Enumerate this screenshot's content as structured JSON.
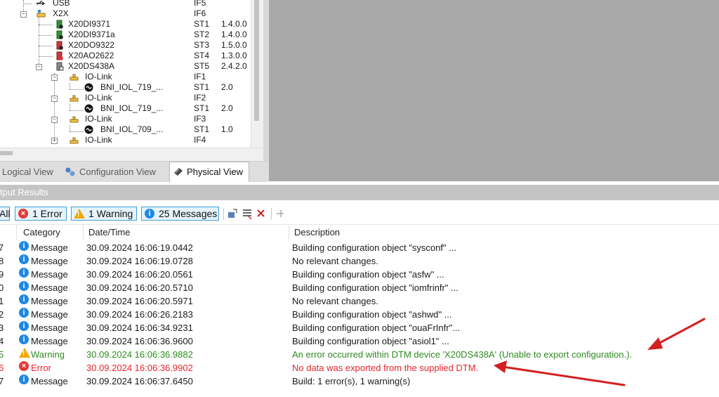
{
  "tree": {
    "items": [
      {
        "label": "USB",
        "slot": "IF5",
        "version": ""
      },
      {
        "label": "X2X",
        "slot": "IF6",
        "version": ""
      },
      {
        "label": "X20DI9371",
        "slot": "ST1",
        "version": "1.4.0.0"
      },
      {
        "label": "X20DI9371a",
        "slot": "ST2",
        "version": "1.4.0.0"
      },
      {
        "label": "X20DO9322",
        "slot": "ST3",
        "version": "1.5.0.0"
      },
      {
        "label": "X20AO2622",
        "slot": "ST4",
        "version": "1.3.0.0"
      },
      {
        "label": "X20DS438A",
        "slot": "ST5",
        "version": "2.4.2.0"
      },
      {
        "label": "IO-Link",
        "slot": "IF1",
        "version": ""
      },
      {
        "label": "BNI_IOL_719_...",
        "slot": "ST1",
        "version": "2.0"
      },
      {
        "label": "IO-Link",
        "slot": "IF2",
        "version": ""
      },
      {
        "label": "BNI_IOL_719_...",
        "slot": "ST1",
        "version": "2.0"
      },
      {
        "label": "IO-Link",
        "slot": "IF3",
        "version": ""
      },
      {
        "label": "BNI_IOL_709_...",
        "slot": "ST1",
        "version": "1.0"
      },
      {
        "label": "IO-Link",
        "slot": "IF4",
        "version": ""
      }
    ]
  },
  "view_tabs": [
    {
      "label": "Logical View",
      "icon": "logical-view-icon"
    },
    {
      "label": "Configuration View",
      "icon": "configuration-view-icon"
    },
    {
      "label": "Physical View",
      "icon": "physical-view-icon",
      "active": true
    }
  ],
  "output": {
    "title": "tput Results",
    "filters": {
      "all_label": "All",
      "error_label": "1 Error",
      "warning_label": "1 Warning",
      "messages_label": "25 Messages"
    },
    "columns": {
      "category": "Category",
      "datetime": "Date/Time",
      "description": "Description"
    },
    "rows": [
      {
        "num": "7",
        "category": "Message",
        "severity": "info",
        "datetime": "30.09.2024 16:06:19.0442",
        "description": "Building configuration object \"sysconf\" ..."
      },
      {
        "num": "8",
        "category": "Message",
        "severity": "info",
        "datetime": "30.09.2024 16:06:19.0728",
        "description": "No relevant changes."
      },
      {
        "num": "9",
        "category": "Message",
        "severity": "info",
        "datetime": "30.09.2024 16:06:20.0561",
        "description": "Building configuration object \"asfw\" ..."
      },
      {
        "num": "0",
        "category": "Message",
        "severity": "info",
        "datetime": "30.09.2024 16:06:20.5710",
        "description": "Building configuration object \"iomfrinfr\" ..."
      },
      {
        "num": "1",
        "category": "Message",
        "severity": "info",
        "datetime": "30.09.2024 16:06:20.5971",
        "description": "No relevant changes."
      },
      {
        "num": "2",
        "category": "Message",
        "severity": "info",
        "datetime": "30.09.2024 16:06:26.2183",
        "description": "Building configuration object \"ashwd\" ..."
      },
      {
        "num": "3",
        "category": "Message",
        "severity": "info",
        "datetime": "30.09.2024 16:06:34.9231",
        "description": "Building configuration object \"ouaFrInfr\"..."
      },
      {
        "num": "4",
        "category": "Message",
        "severity": "info",
        "datetime": "30.09.2024 16:06:36.9600",
        "description": "Building configuration object \"asiol1\" ..."
      },
      {
        "num": "5",
        "category": "Warning",
        "severity": "warning",
        "datetime": "30.09.2024 16:06:36.9882",
        "description": "An error occurred within DTM device 'X20DS438A' (Unable to export configuration.)."
      },
      {
        "num": "6",
        "category": "Error",
        "severity": "error",
        "datetime": "30.09.2024 16:06:36.9902",
        "description": "No data was exported from the supplied DTM."
      },
      {
        "num": "7",
        "category": "Message",
        "severity": "info",
        "datetime": "30.09.2024 16:06:37.6450",
        "description": "Build: 1 error(s), 1 warning(s)"
      }
    ]
  },
  "colors": {
    "warning_text": "#2e8b20",
    "error_text": "#e3262d",
    "annotation_arrow": "#d32020",
    "canvas_gray": "#a9a9a9"
  }
}
